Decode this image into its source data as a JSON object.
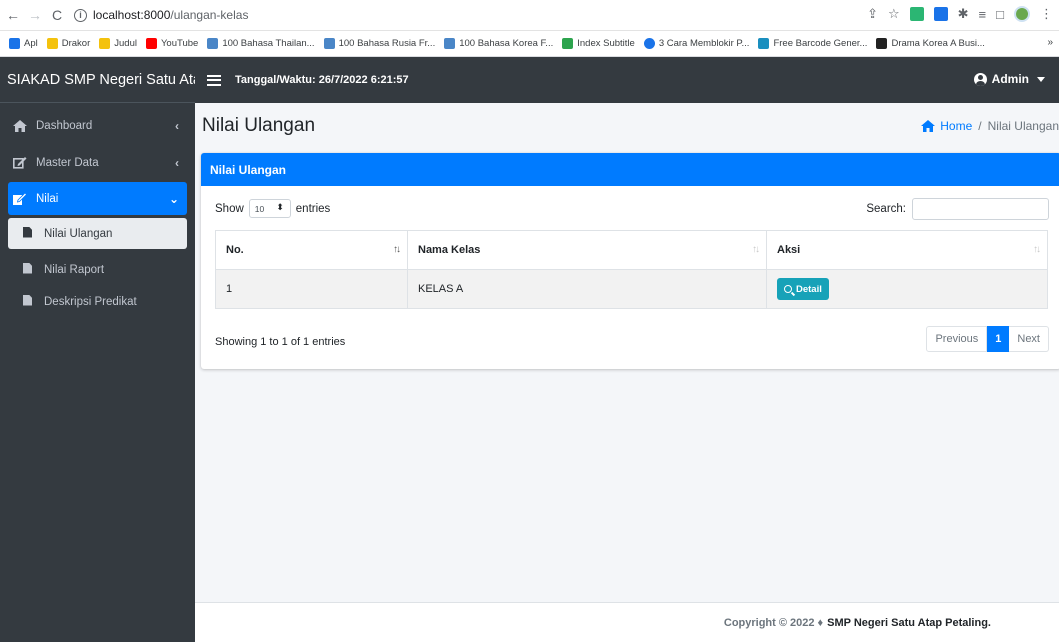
{
  "browser": {
    "url_host": "localhost:8000",
    "url_path": "/ulangan-kelas",
    "bookmarks": [
      {
        "label": "Apl",
        "color": "#1a73e8"
      },
      {
        "label": "Drakor",
        "color": "#f4c20d"
      },
      {
        "label": "Judul",
        "color": "#f4c20d"
      },
      {
        "label": "YouTube",
        "color": "#ff0000"
      },
      {
        "label": "100 Bahasa Thailan...",
        "color": "#4a86c7"
      },
      {
        "label": "100 Bahasa Rusia Fr...",
        "color": "#4a86c7"
      },
      {
        "label": "100 Bahasa Korea F...",
        "color": "#4a86c7"
      },
      {
        "label": "Index Subtitle",
        "color": "#2da44e"
      },
      {
        "label": "3 Cara Memblokir P...",
        "color": "#1a73e8"
      },
      {
        "label": "Free Barcode Gener...",
        "color": "#1a8fbf"
      },
      {
        "label": "Drama Korea A Busi...",
        "color": "#222222"
      }
    ],
    "more": "»"
  },
  "app": {
    "brand": "SIAKAD SMP Negeri Satu Atap",
    "datetime": "Tanggal/Waktu: 26/7/2022 6:21:57",
    "user": "Admin"
  },
  "sidebar": {
    "items": [
      {
        "label": "Dashboard",
        "icon": "home-icon"
      },
      {
        "label": "Master Data",
        "icon": "edit-icon"
      },
      {
        "label": "Nilai",
        "icon": "edit-icon"
      }
    ],
    "sub_items": [
      {
        "label": "Nilai Ulangan"
      },
      {
        "label": "Nilai Raport"
      },
      {
        "label": "Deskripsi Predikat"
      }
    ]
  },
  "page": {
    "title": "Nilai Ulangan",
    "breadcrumb_home": "Home",
    "breadcrumb_sep": "/",
    "breadcrumb_current": "Nilai Ulangan"
  },
  "card": {
    "header": "Nilai Ulangan",
    "show_label": "Show",
    "show_value": "10",
    "entries_label": "entries",
    "search_label": "Search:",
    "columns": [
      "No.",
      "Nama Kelas",
      "Aksi"
    ],
    "rows": [
      {
        "no": "1",
        "kelas": "KELAS A",
        "action": "Detail"
      }
    ],
    "info": "Showing 1 to 1 of 1 entries",
    "pager": {
      "prev": "Previous",
      "current": "1",
      "next": "Next"
    }
  },
  "footer": {
    "copyright": "Copyright © 2022 ♦",
    "org": "SMP Negeri Satu Atap Petaling."
  },
  "colors": {
    "primary": "#007bff",
    "sidebar": "#343a40",
    "info": "#17a2b8"
  }
}
